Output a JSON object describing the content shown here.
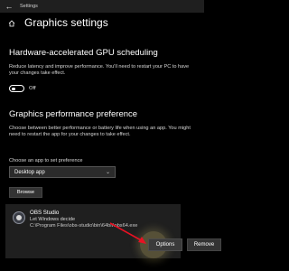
{
  "window": {
    "title": "Settings"
  },
  "page": {
    "title": "Graphics settings"
  },
  "gpu_scheduling": {
    "heading": "Hardware-accelerated GPU scheduling",
    "description": "Reduce latency and improve performance. You'll need to restart your PC to have your changes take effect.",
    "toggle_state": "Off"
  },
  "graphics_pref": {
    "heading": "Graphics performance preference",
    "description": "Choose between better performance or battery life when using an app. You might need to restart the app for your changes to take effect.",
    "choose_label": "Choose an app to set preference",
    "dropdown_value": "Desktop app",
    "browse_label": "Browse"
  },
  "app": {
    "name": "OBS Studio",
    "preference": "Let Windows decide",
    "path": "C:\\Program Files\\obs-studio\\bin\\64bit\\obs64.exe",
    "options_label": "Options",
    "remove_label": "Remove"
  },
  "colors": {
    "background": "#000000",
    "card": "#1f1f1f",
    "arrow": "#e81123"
  },
  "icons": {
    "back": "back-arrow-icon",
    "home": "home-icon",
    "chevron": "chevron-down-icon",
    "app": "obs-icon",
    "annotation": "red-arrow-icon"
  }
}
